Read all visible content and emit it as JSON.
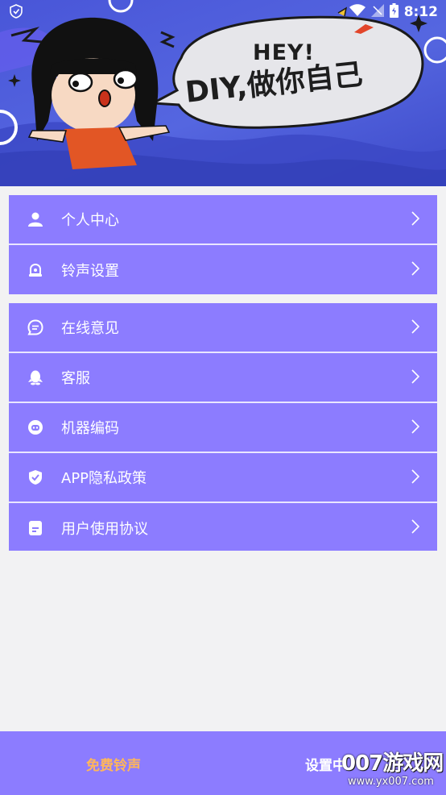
{
  "status_bar": {
    "time": "8:12"
  },
  "banner": {
    "greeting": "HEY!",
    "slogan": "DIY,做你自己"
  },
  "menu": {
    "group1": [
      {
        "label": "个人中心",
        "icon": "user-icon"
      },
      {
        "label": "铃声设置",
        "icon": "bell-icon"
      }
    ],
    "group2": [
      {
        "label": "在线意见",
        "icon": "chat-icon"
      },
      {
        "label": "客服",
        "icon": "penguin-icon"
      },
      {
        "label": "机器编码",
        "icon": "robot-icon"
      },
      {
        "label": "APP隐私政策",
        "icon": "shield-check-icon"
      },
      {
        "label": "用户使用协议",
        "icon": "document-icon"
      }
    ]
  },
  "bottom_nav": {
    "free_ringtones": "免费铃声",
    "settings_center": "设置中"
  },
  "watermark": {
    "site": "007游戏网",
    "url": "www.yx007.com"
  },
  "colors": {
    "accent": "#8c7cff",
    "banner": "#4956d8",
    "active_tab": "#ffb65a"
  }
}
